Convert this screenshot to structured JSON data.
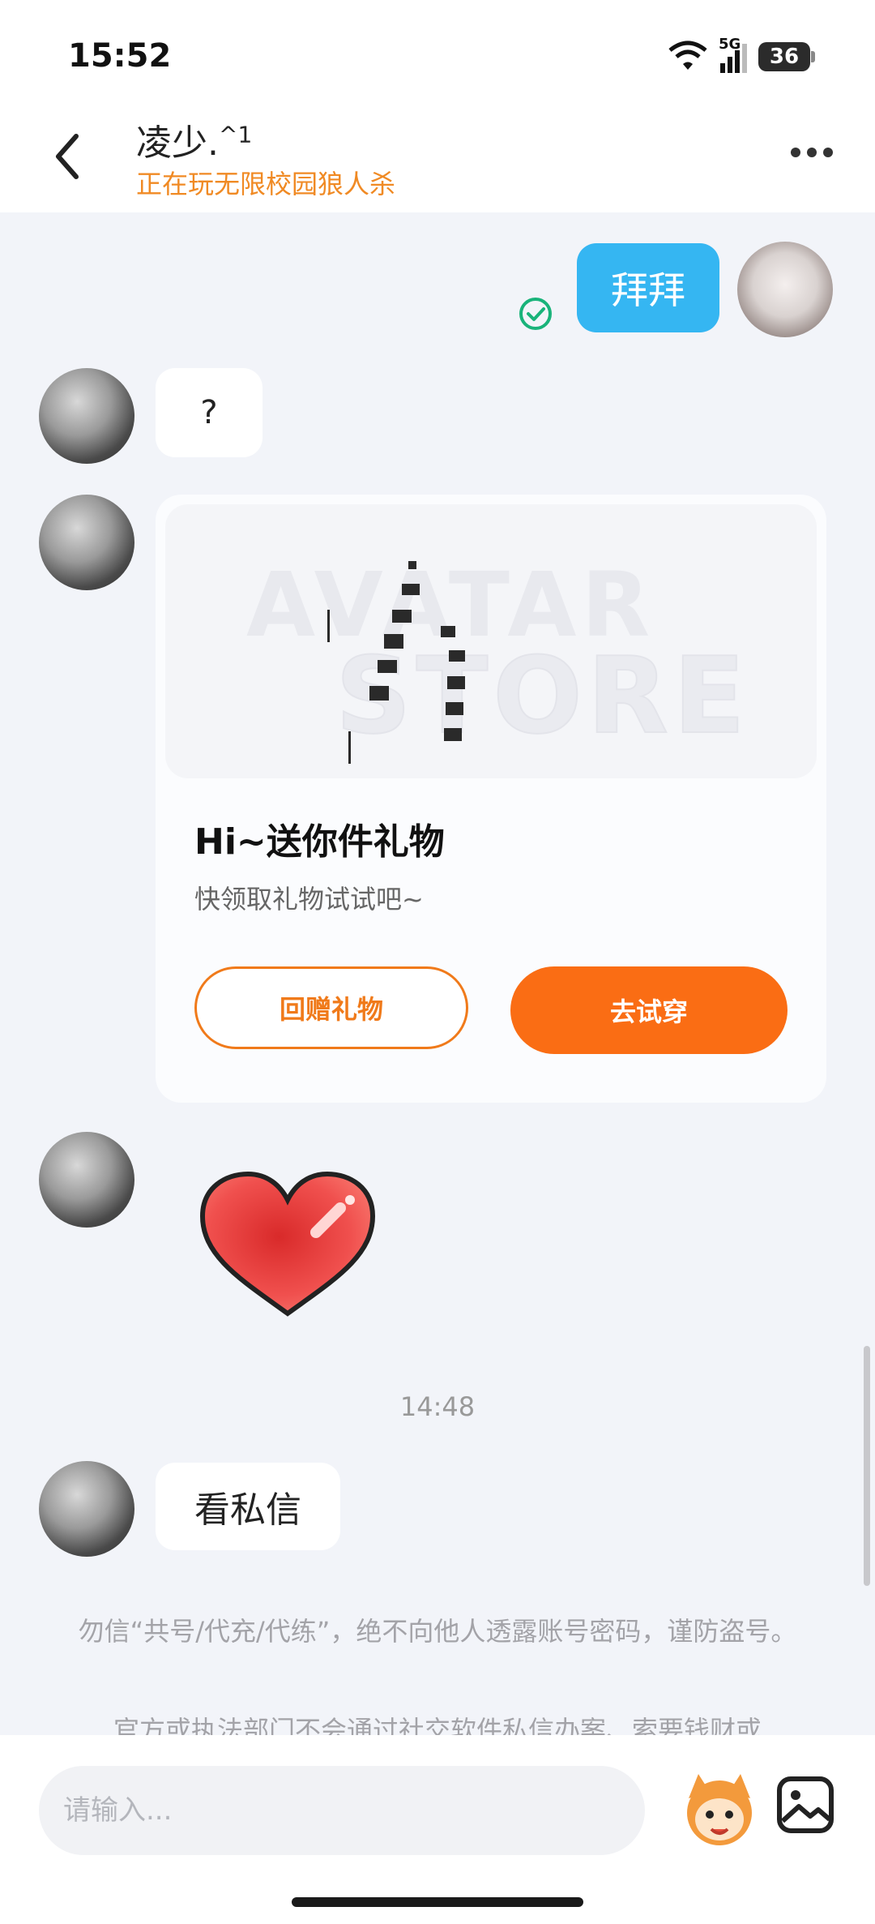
{
  "status_bar": {
    "time": "15:52",
    "network": "5G",
    "battery": "36"
  },
  "header": {
    "contact_name": "凌少.",
    "name_suffix": "^1",
    "status": "正在玩无限校园狼人杀"
  },
  "messages": {
    "me_text": "拜拜",
    "reply_1": "?",
    "gift_card": {
      "watermark_top": "AVATAR",
      "watermark_bottom": "STORE",
      "title": "Hi~送你件礼物",
      "subtitle": "快领取礼物试试吧~",
      "btn_return": "回赠礼物",
      "btn_try": "去试穿"
    },
    "timestamp": "14:48",
    "reply_2": "看私信"
  },
  "notices": {
    "line1": "勿信“共号/代充/代练”，绝不向他人透露账号密码，谨防盗号。",
    "line2": "官方或执法部门不会通过社交软件私信办案、索要钱财或"
  },
  "input": {
    "placeholder": "请输入..."
  },
  "colors": {
    "bubble_me": "#35b6f2",
    "accent_orange": "#fa6d14",
    "status_orange": "#f08a24"
  }
}
